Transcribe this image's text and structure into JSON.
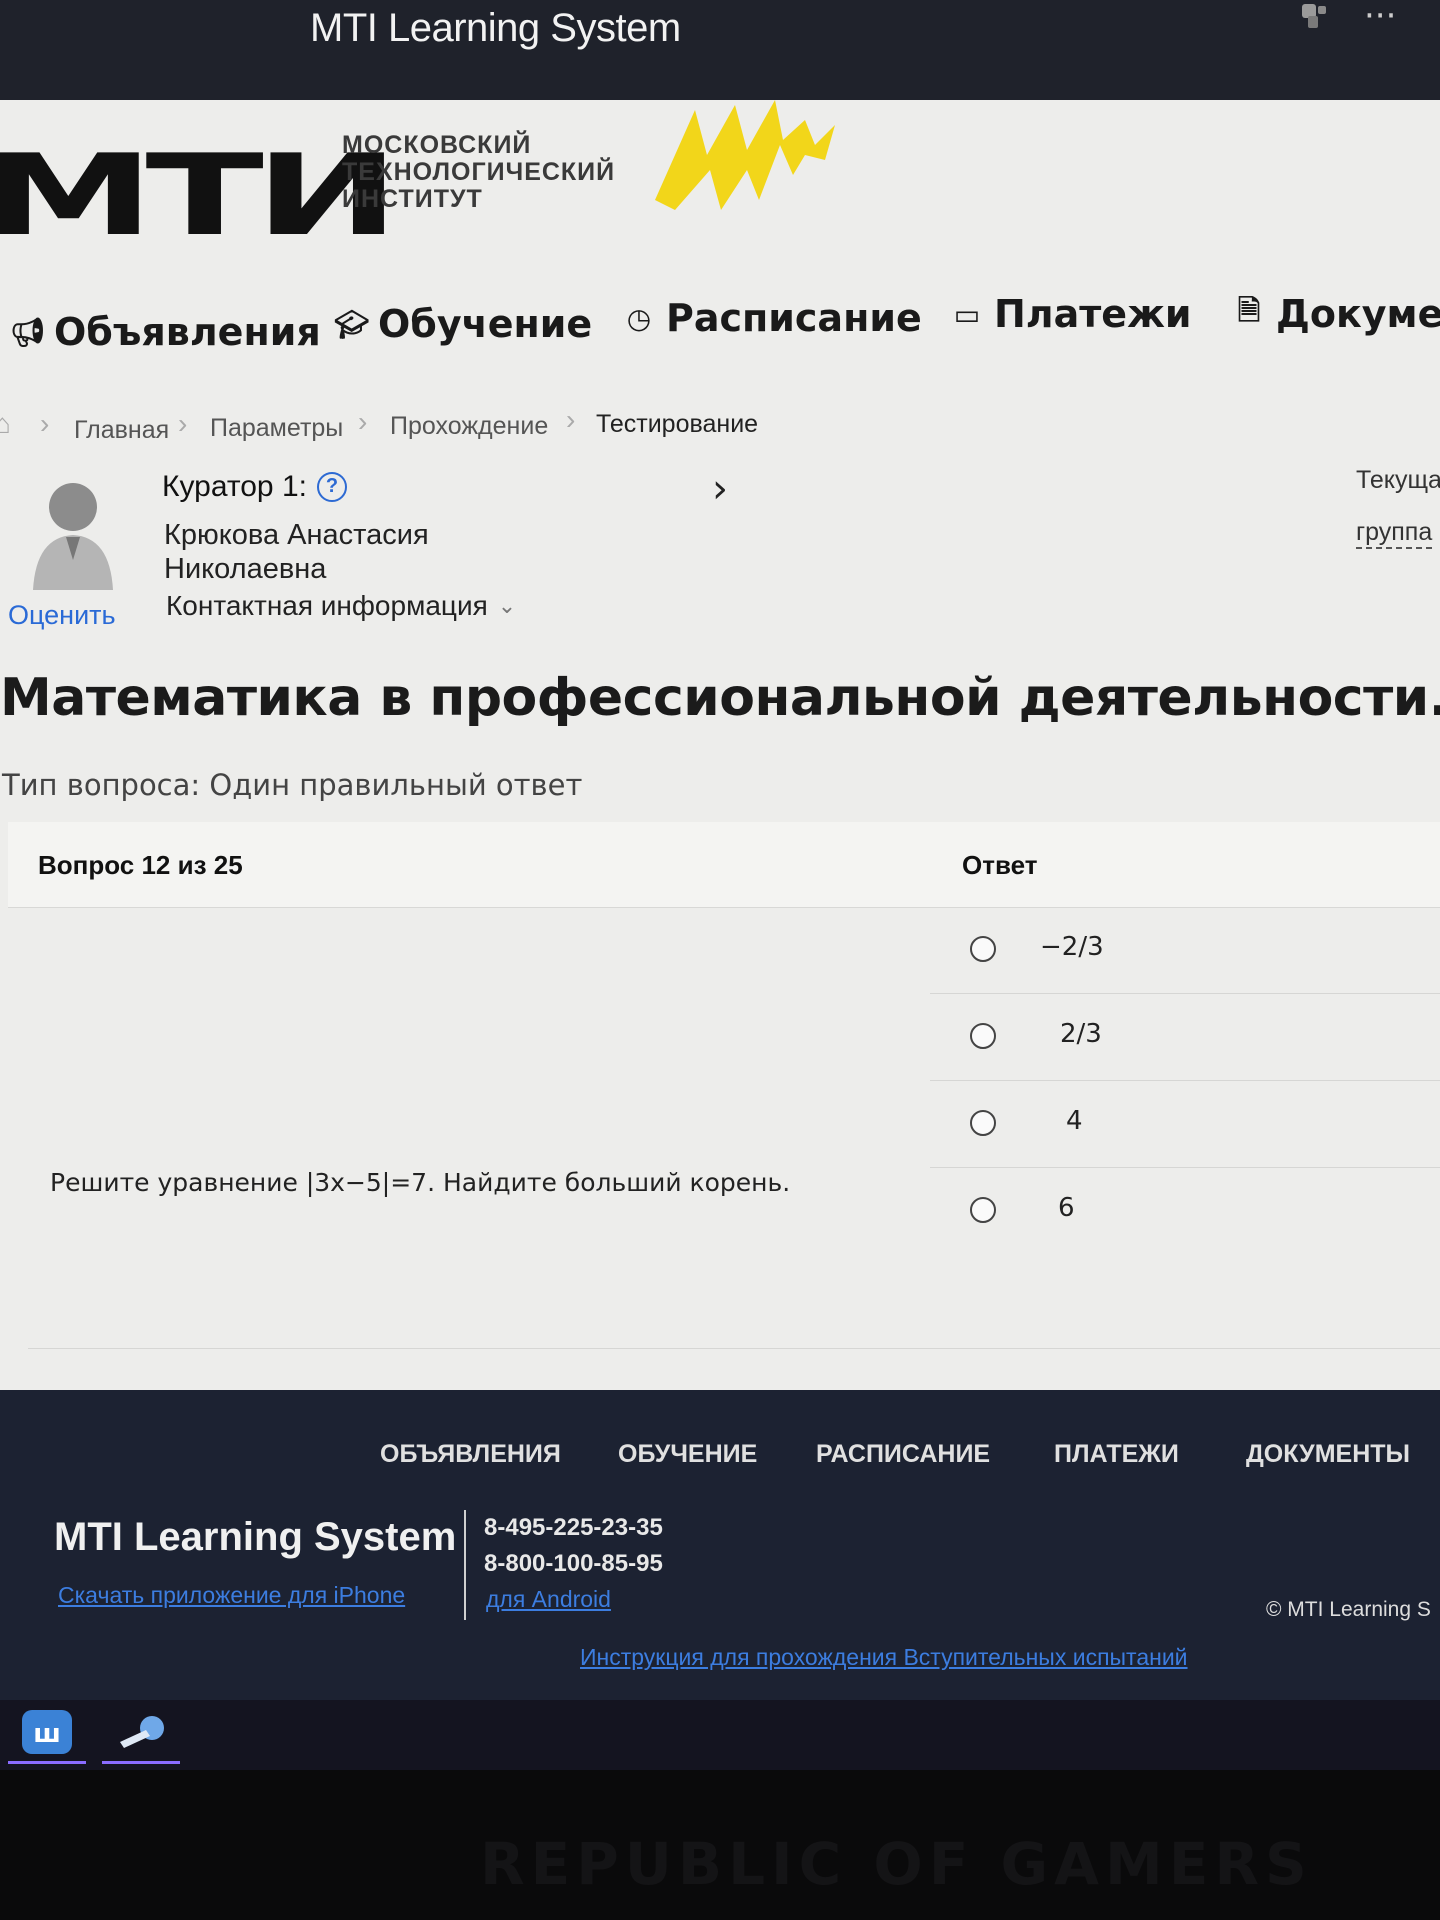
{
  "window": {
    "title": "MTI Learning System",
    "more_icon": "more-dots-icon"
  },
  "logo": {
    "mark": "МТИ",
    "subtitle": [
      "МОСКОВСКИЙ",
      "ТЕХНОЛОГИЧЕСКИЙ",
      "ИНСТИТУТ"
    ],
    "accent_color": "#f2d61a"
  },
  "nav": [
    {
      "label": "Объявления",
      "icon": "megaphone-icon"
    },
    {
      "label": "Обучение",
      "icon": "graduation-cap-icon"
    },
    {
      "label": "Расписание",
      "icon": "clock-icon"
    },
    {
      "label": "Платежи",
      "icon": "credit-card-icon"
    },
    {
      "label": "Докумен",
      "icon": "document-icon"
    }
  ],
  "breadcrumb": [
    "Главная",
    "Параметры",
    "Прохождение",
    "Тестирование"
  ],
  "curator": {
    "label": "Куратор 1:",
    "name": "Крюкова Анастасия Николаевна",
    "contact": "Контактная информация",
    "rate": "Оценить"
  },
  "side": {
    "current": "Текуща",
    "group": "группа"
  },
  "course": {
    "title": "Математика в профессиональной деятельности.",
    "question_type": "Тип вопроса: Один правильный ответ"
  },
  "question": {
    "counter": "Вопрос 12 из 25",
    "answer_header": "Ответ",
    "text": "Решите уравнение |3x−5|=7. Найдите больший корень.",
    "options": [
      "−2/3",
      "2/3",
      "4",
      "6"
    ]
  },
  "footer": {
    "nav": [
      "ОБЪЯВЛЕНИЯ",
      "ОБУЧЕНИЕ",
      "РАСПИСАНИЕ",
      "ПЛАТЕЖИ",
      "ДОКУМЕНТЫ"
    ],
    "brand": "MTI Learning System",
    "iphone_link": "Скачать приложение для iPhone",
    "phones": [
      "8-495-225-23-35",
      "8-800-100-85-95"
    ],
    "android_link": "для Android",
    "copyright": "© MTI Learning S",
    "instructions_link": "Инструкция для прохождения Вступительных испытаний"
  },
  "bezel_text": "REPUBLIC OF GAMERS"
}
